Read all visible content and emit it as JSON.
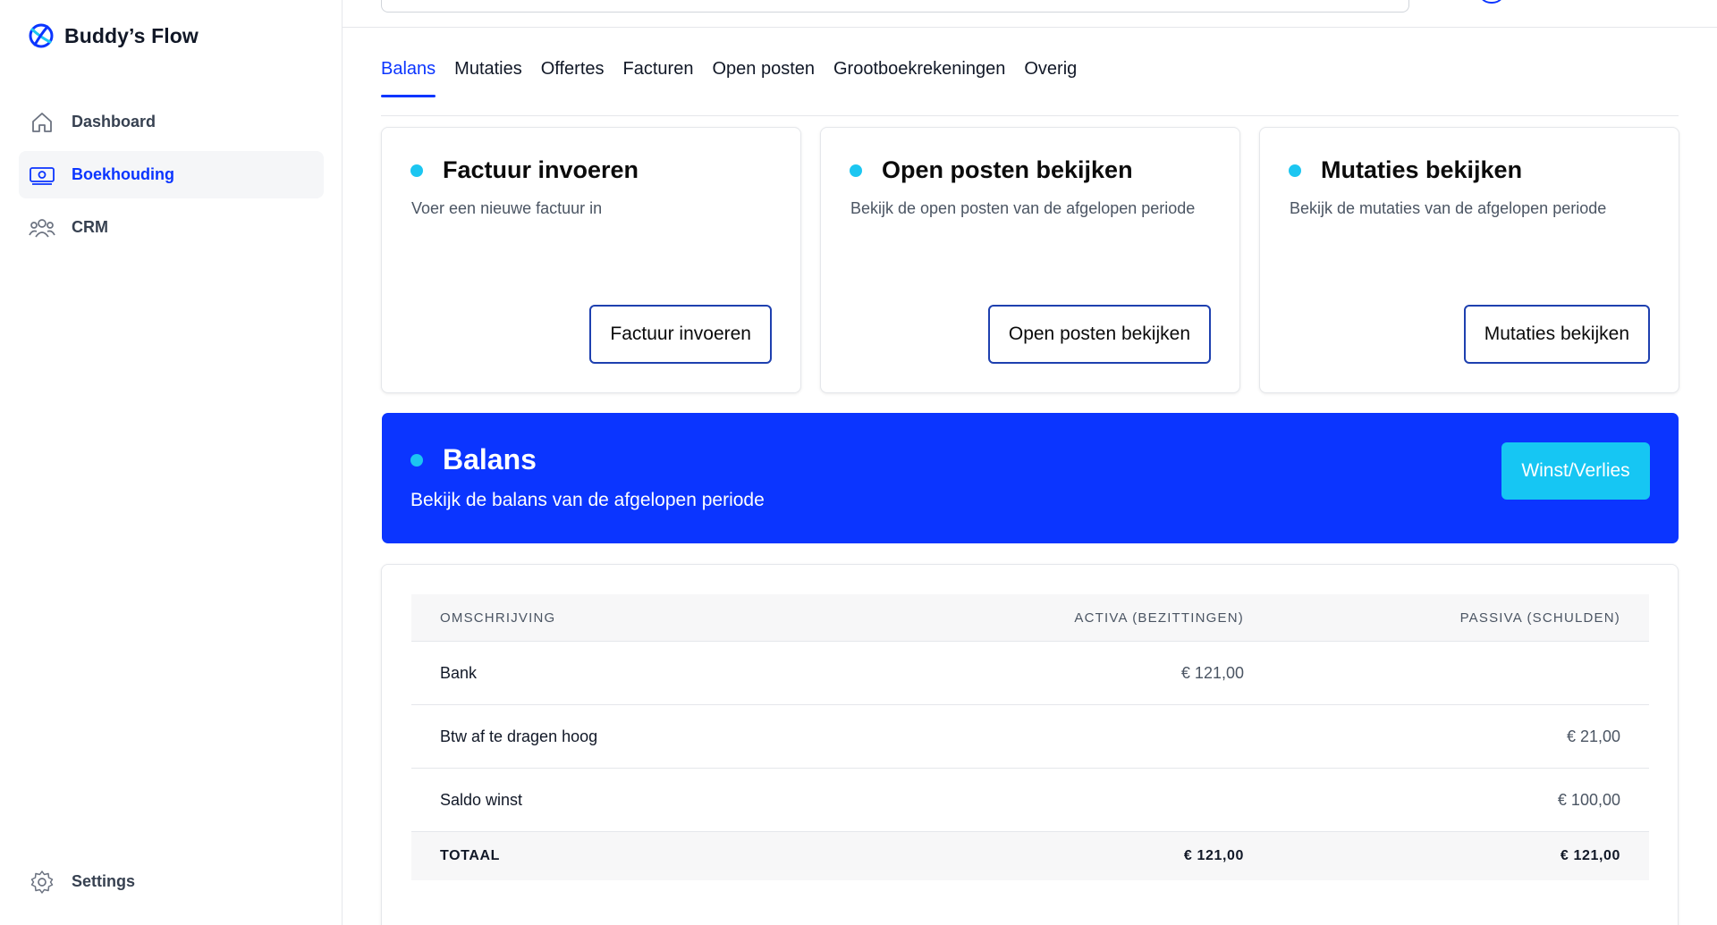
{
  "brand": {
    "name": "Buddy’s Flow",
    "accent": "#0b35ff"
  },
  "sidebar": {
    "items": [
      {
        "label": "Dashboard",
        "icon": "home-icon",
        "active": false
      },
      {
        "label": "Boekhouding",
        "icon": "banknote-icon",
        "active": true
      },
      {
        "label": "CRM",
        "icon": "users-icon",
        "active": false
      }
    ],
    "settings_label": "Settings"
  },
  "tabs": [
    "Balans",
    "Mutaties",
    "Offertes",
    "Facturen",
    "Open posten",
    "Grootboekrekeningen",
    "Overig"
  ],
  "active_tab": "Balans",
  "cards": [
    {
      "title": "Factuur invoeren",
      "description": "Voer een nieuwe factuur in",
      "button": "Factuur invoeren"
    },
    {
      "title": "Open posten bekijken",
      "description": "Bekijk de open posten van de afgelopen periode",
      "button": "Open posten bekijken"
    },
    {
      "title": "Mutaties bekijken",
      "description": "Bekijk de mutaties van de afgelopen periode",
      "button": "Mutaties bekijken"
    }
  ],
  "banner": {
    "title": "Balans",
    "description": "Bekijk de balans van de afgelopen periode",
    "button": "Winst/Verlies",
    "color": "#0b35ff",
    "button_color": "#16c6f3"
  },
  "table": {
    "headers": [
      "OMSCHRIJVING",
      "ACTIVA (BEZITTINGEN)",
      "PASSIVA (SCHULDEN)"
    ],
    "rows": [
      [
        "Bank",
        "€ 121,00",
        ""
      ],
      [
        "Btw af te dragen hoog",
        "",
        "€ 21,00"
      ],
      [
        "Saldo winst",
        "",
        "€ 100,00"
      ]
    ],
    "total": [
      "TOTAAL",
      "€ 121,00",
      "€ 121,00"
    ]
  }
}
